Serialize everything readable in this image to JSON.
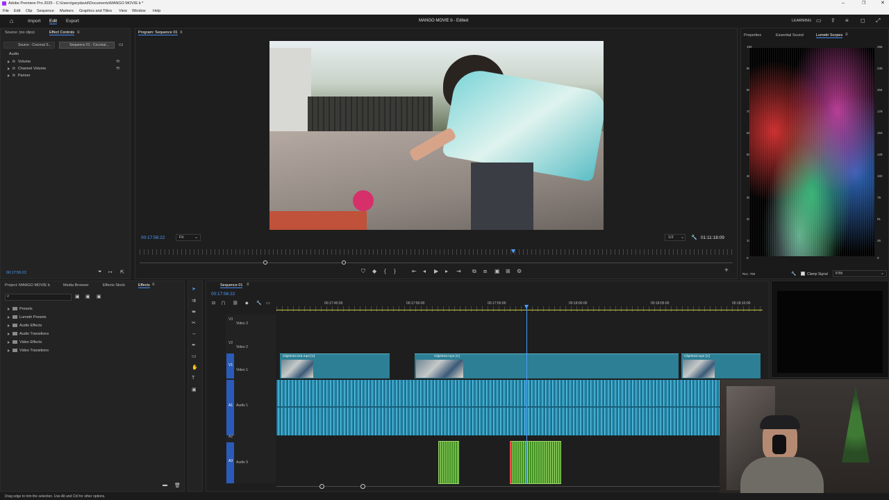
{
  "window": {
    "title": "Adobe Premiere Pro 2025 - C:\\Users\\garydavid\\Documents\\MANGO MOVIE b *",
    "controls": [
      "minimize",
      "restore",
      "close"
    ]
  },
  "menu": [
    "File",
    "Edit",
    "Clip",
    "Sequence",
    "Markers",
    "Graphics and Titles",
    "View",
    "Window",
    "Help"
  ],
  "appbar": {
    "home_icon": "home-icon",
    "tabs": [
      "Import",
      "Edit",
      "Export"
    ],
    "active_tab": "Edit",
    "project_title": "MANGO MOVIE b",
    "status": "- Edited",
    "learning": "LEARNING"
  },
  "effect_controls": {
    "tabs": [
      "Source: (no clips)",
      "Effect Controls"
    ],
    "source_clip": "Source - Coconut S...",
    "sequence_clip": "Sequence 01 - Coconut...",
    "section": "Audio",
    "effects": [
      "Volume",
      "Channel Volume",
      "Panner"
    ],
    "timecode": "00:17:56:22"
  },
  "program": {
    "title": "Program: Sequence 01",
    "timecode": "00:17:56:22",
    "fit": "Fit",
    "quality": "1/2",
    "duration": "01:11:18:09",
    "playhead_fraction": 0.63
  },
  "scopes": {
    "tabs": [
      "Properties",
      "Essential Sound",
      "Lumetri Scopes"
    ],
    "active_tab": "Lumetri Scopes",
    "left_scale": [
      "100",
      "90",
      "80",
      "70",
      "60",
      "50",
      "40",
      "30",
      "20",
      "10",
      "0"
    ],
    "right_scale": [
      "255",
      "230",
      "204",
      "179",
      "153",
      "128",
      "102",
      "76",
      "51",
      "26",
      "0"
    ],
    "footer_left": "Rec. 709",
    "clamp_signal": "Clamp Signal",
    "bit_depth": "8 Bit"
  },
  "project": {
    "tabs": [
      "Project: MANGO MOVIE b",
      "Media Browser",
      "Effects Stock",
      "Effects"
    ],
    "active_tab": "Effects",
    "folders": [
      "Presets",
      "Lumetri Presets",
      "Audio Effects",
      "Audio Transitions",
      "Video Effects",
      "Video Transitions"
    ]
  },
  "timeline": {
    "tab": "Sequence 01",
    "timecode": "00:17:56:22",
    "ruler": [
      "00:17:45:00",
      "00:17:50:00",
      "00:17:55:00",
      "00:18:00:00",
      "00:18:05:00",
      "00:18:10:00"
    ],
    "tracks": {
      "v3": "V3",
      "v3_name": "Video 3",
      "v2": "V2",
      "v2_name": "Video 2",
      "v1": "V1",
      "v1_name": "Video 1",
      "a1": "A1",
      "a1_name": "Audio 1",
      "a2": "A2",
      "a3": "A3",
      "a3_name": "Audio 3"
    },
    "clips": [
      "Clip0043.015.mp4 [V]",
      "Clip0043.mp4 [V]",
      "Clip0043.mp4 [V]"
    ]
  },
  "status_bar": "Drag edge to trim the selection. Use Alt and Ctrl for other options."
}
